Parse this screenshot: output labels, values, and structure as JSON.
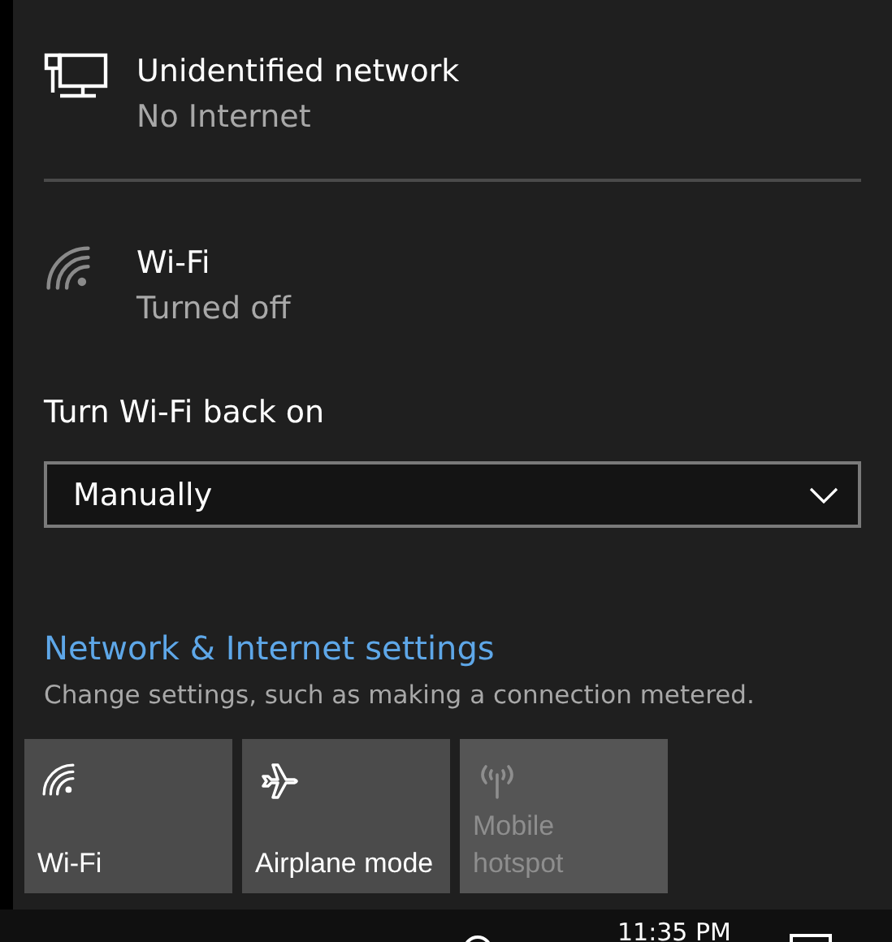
{
  "networks": [
    {
      "kind": "ethernet",
      "name": "Unidentified network",
      "status": "No Internet"
    },
    {
      "kind": "wifi",
      "name": "Wi-Fi",
      "status": "Turned off"
    }
  ],
  "wifi_reenable": {
    "label": "Turn Wi-Fi back on",
    "value": "Manually"
  },
  "settings_link": {
    "label": "Network & Internet settings",
    "description": "Change settings, such as making a connection metered."
  },
  "quick_actions": [
    {
      "kind": "wifi",
      "label": "Wi-Fi",
      "on": false,
      "disabled": false
    },
    {
      "kind": "airplane",
      "label": "Airplane mode",
      "on": false,
      "disabled": false
    },
    {
      "kind": "hotspot",
      "label": "Mobile hotspot",
      "on": false,
      "disabled": true
    }
  ],
  "taskbar": {
    "clock": "11:35 PM"
  }
}
